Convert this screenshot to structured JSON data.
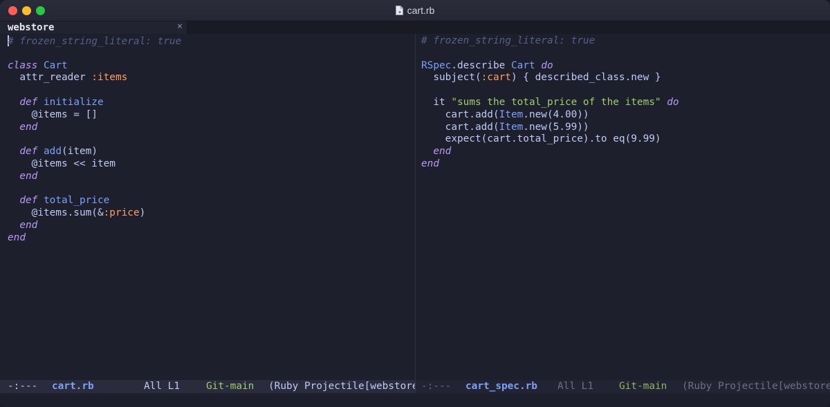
{
  "window": {
    "title": "cart.rb"
  },
  "colors": {
    "background": "#1e1f2c",
    "keyword": "#bb9af7",
    "class": "#7aa2f7",
    "symbol": "#ff9e64",
    "string": "#9ece6a",
    "comment": "#565f89"
  },
  "tab": {
    "label": "webstore",
    "close": "×"
  },
  "left_pane": {
    "lines": [
      [
        {
          "t": "cmt",
          "v": "# frozen_string_literal: true"
        }
      ],
      [],
      [
        {
          "t": "kw",
          "v": "class"
        },
        {
          "t": "p",
          "v": " "
        },
        {
          "t": "cls",
          "v": "Cart"
        }
      ],
      [
        {
          "t": "p",
          "v": "  attr_reader "
        },
        {
          "t": "sym",
          "v": ":items"
        }
      ],
      [],
      [
        {
          "t": "p",
          "v": "  "
        },
        {
          "t": "kw",
          "v": "def"
        },
        {
          "t": "p",
          "v": " "
        },
        {
          "t": "fn",
          "v": "initialize"
        }
      ],
      [
        {
          "t": "p",
          "v": "    @items = []"
        }
      ],
      [
        {
          "t": "p",
          "v": "  "
        },
        {
          "t": "kw",
          "v": "end"
        }
      ],
      [],
      [
        {
          "t": "p",
          "v": "  "
        },
        {
          "t": "kw",
          "v": "def"
        },
        {
          "t": "p",
          "v": " "
        },
        {
          "t": "fn",
          "v": "add"
        },
        {
          "t": "p",
          "v": "(item)"
        }
      ],
      [
        {
          "t": "p",
          "v": "    @items << item"
        }
      ],
      [
        {
          "t": "p",
          "v": "  "
        },
        {
          "t": "kw",
          "v": "end"
        }
      ],
      [],
      [
        {
          "t": "p",
          "v": "  "
        },
        {
          "t": "kw",
          "v": "def"
        },
        {
          "t": "p",
          "v": " "
        },
        {
          "t": "fn",
          "v": "total_price"
        }
      ],
      [
        {
          "t": "p",
          "v": "    @items.sum(&"
        },
        {
          "t": "sym",
          "v": ":price"
        },
        {
          "t": "p",
          "v": ")"
        }
      ],
      [
        {
          "t": "p",
          "v": "  "
        },
        {
          "t": "kw",
          "v": "end"
        }
      ],
      [
        {
          "t": "kw",
          "v": "end"
        }
      ]
    ]
  },
  "right_pane": {
    "lines": [
      [
        {
          "t": "cmt",
          "v": "# frozen_string_literal: true"
        }
      ],
      [],
      [
        {
          "t": "cls",
          "v": "RSpec"
        },
        {
          "t": "p",
          "v": ".describe "
        },
        {
          "t": "cls",
          "v": "Cart"
        },
        {
          "t": "p",
          "v": " "
        },
        {
          "t": "kw",
          "v": "do"
        }
      ],
      [
        {
          "t": "p",
          "v": "  subject("
        },
        {
          "t": "sym",
          "v": ":cart"
        },
        {
          "t": "p",
          "v": ") { described_class.new }"
        }
      ],
      [],
      [
        {
          "t": "p",
          "v": "  it "
        },
        {
          "t": "str",
          "v": "\"sums the total_price of the items\""
        },
        {
          "t": "p",
          "v": " "
        },
        {
          "t": "kw",
          "v": "do"
        }
      ],
      [
        {
          "t": "p",
          "v": "    cart.add("
        },
        {
          "t": "cls",
          "v": "Item"
        },
        {
          "t": "p",
          "v": ".new(4.00))"
        }
      ],
      [
        {
          "t": "p",
          "v": "    cart.add("
        },
        {
          "t": "cls",
          "v": "Item"
        },
        {
          "t": "p",
          "v": ".new(5.99))"
        }
      ],
      [
        {
          "t": "p",
          "v": "    expect(cart.total_price).to eq(9.99)"
        }
      ],
      [
        {
          "t": "p",
          "v": "  "
        },
        {
          "t": "kw",
          "v": "end"
        }
      ],
      [
        {
          "t": "kw",
          "v": "end"
        }
      ]
    ]
  },
  "modeline_left": {
    "status": "-:---",
    "buffer": "cart.rb",
    "position": "All L1",
    "branch": "Git-main",
    "modes": "(Ruby Projectile[webstore]"
  },
  "modeline_right": {
    "status": "-:---",
    "buffer": "cart_spec.rb",
    "position": "All L1",
    "branch": "Git-main",
    "modes": "(Ruby Projectile[webstore]"
  }
}
